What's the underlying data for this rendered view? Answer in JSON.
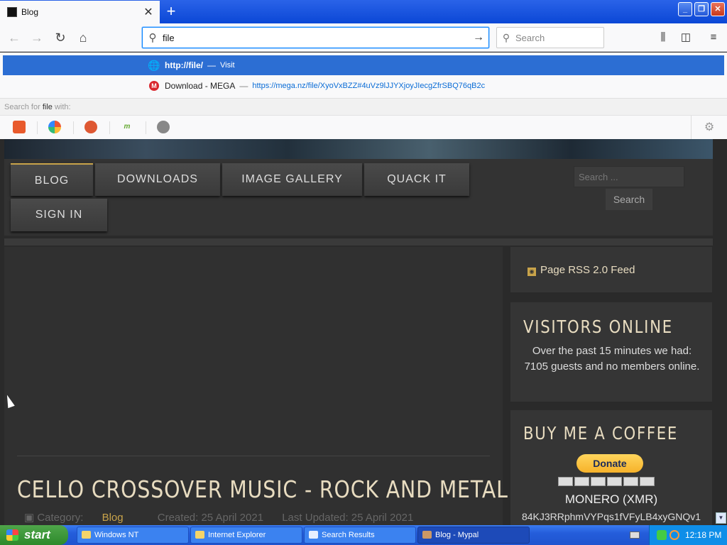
{
  "browser": {
    "tab_title": "Blog",
    "tab_close": "✕",
    "new_tab": "+",
    "url_value": "file",
    "search_placeholder": "Search",
    "window_controls": {
      "minimize": "_",
      "maximize": "❐",
      "close": "✕"
    }
  },
  "dropdown": {
    "visit": {
      "url": "http://file/",
      "separator": "—",
      "action": "Visit"
    },
    "mega": {
      "title": "Download - MEGA",
      "separator": "—",
      "url": "https://mega.nz/file/XyoVxBZZ#4uVz9lJJYXjoyJIecgZfrSBQ76qB2c"
    },
    "search_for": {
      "prefix": "Search for",
      "term": "file",
      "suffix": "with:"
    }
  },
  "site": {
    "menu": [
      "BLOG",
      "DOWNLOADS",
      "IMAGE GALLERY",
      "QUACK IT",
      "SIGN IN"
    ],
    "search_placeholder": "Search ...",
    "search_button": "Search",
    "article": {
      "title": "CELLO CROSSOVER MUSIC - ROCK AND METAL",
      "category_label": "Category:",
      "category": "Blog",
      "created": "Created: 25 April 2021",
      "updated": "Last Updated: 25 April 2021"
    },
    "rss": "Page RSS 2.0 Feed",
    "visitors": {
      "title": "VISITORS ONLINE",
      "text": "Over the past 15 minutes we had: 7105 guests and no members online."
    },
    "coffee": {
      "title": "BUY ME A COFFEE",
      "donate": "Donate",
      "currency": "MONERO (XMR)",
      "wallet": "84KJ3RRphmVYPqs1fVFyLB4xyGNQv1"
    }
  },
  "taskbar": {
    "start": "start",
    "tasks": [
      "Windows NT",
      "Internet Explorer",
      "Search Results",
      "Blog - Mypal"
    ],
    "clock": "12:18 PM"
  }
}
